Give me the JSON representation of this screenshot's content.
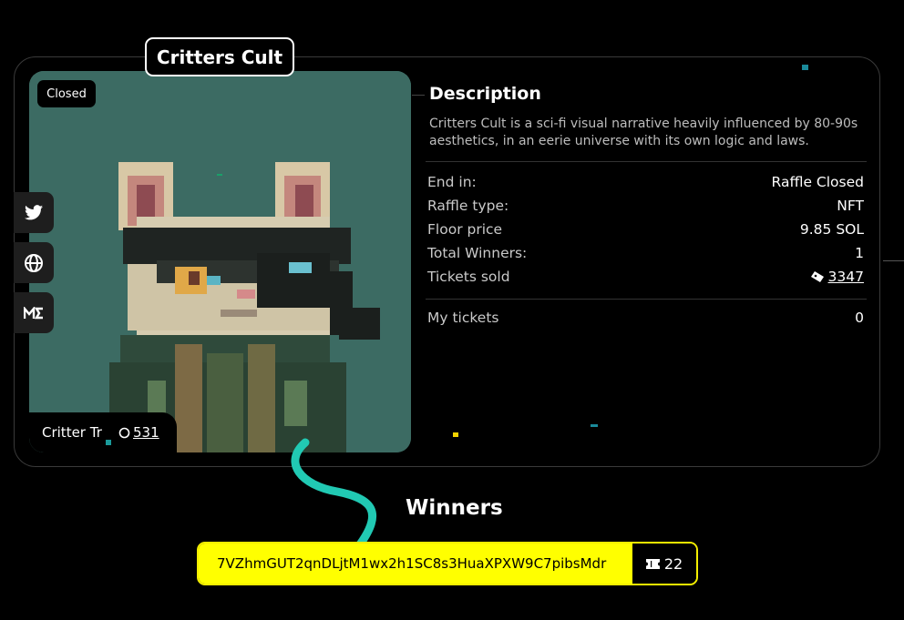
{
  "title": "Critters Cult",
  "status_badge": "Closed",
  "social": {
    "icons": [
      "twitter-icon",
      "globe-icon",
      "magic-eden-icon"
    ]
  },
  "collection": {
    "name": "Critter Tr",
    "count": "531",
    "icon": "circle-icon"
  },
  "description": {
    "heading": "Description",
    "text": "Critters Cult is a sci-fi visual narrative heavily influenced by 80-90s aesthetics, in an eerie universe with its own logic and laws."
  },
  "details": [
    {
      "label": "End in:",
      "value": "Raffle Closed"
    },
    {
      "label": "Raffle type:",
      "value": "NFT"
    },
    {
      "label": "Floor price",
      "value": "9.85 SOL"
    },
    {
      "label": "Total Winners:",
      "value": "1"
    },
    {
      "label": "Tickets sold",
      "value": "3347",
      "icon": "ticket-icon"
    }
  ],
  "my_tickets": {
    "label": "My tickets",
    "value": "0"
  },
  "winners": {
    "heading": "Winners",
    "address": "7VZhmGUT2qnDLjtM1wx2h1SC8s3HuaXPXW9C7pibsMdr",
    "tickets": "22",
    "icon": "ticket-icon"
  },
  "colors": {
    "accent_yellow": "#ffff00",
    "art_bg": "#3c6b63",
    "teal_ribbon": "#21c9b3"
  }
}
